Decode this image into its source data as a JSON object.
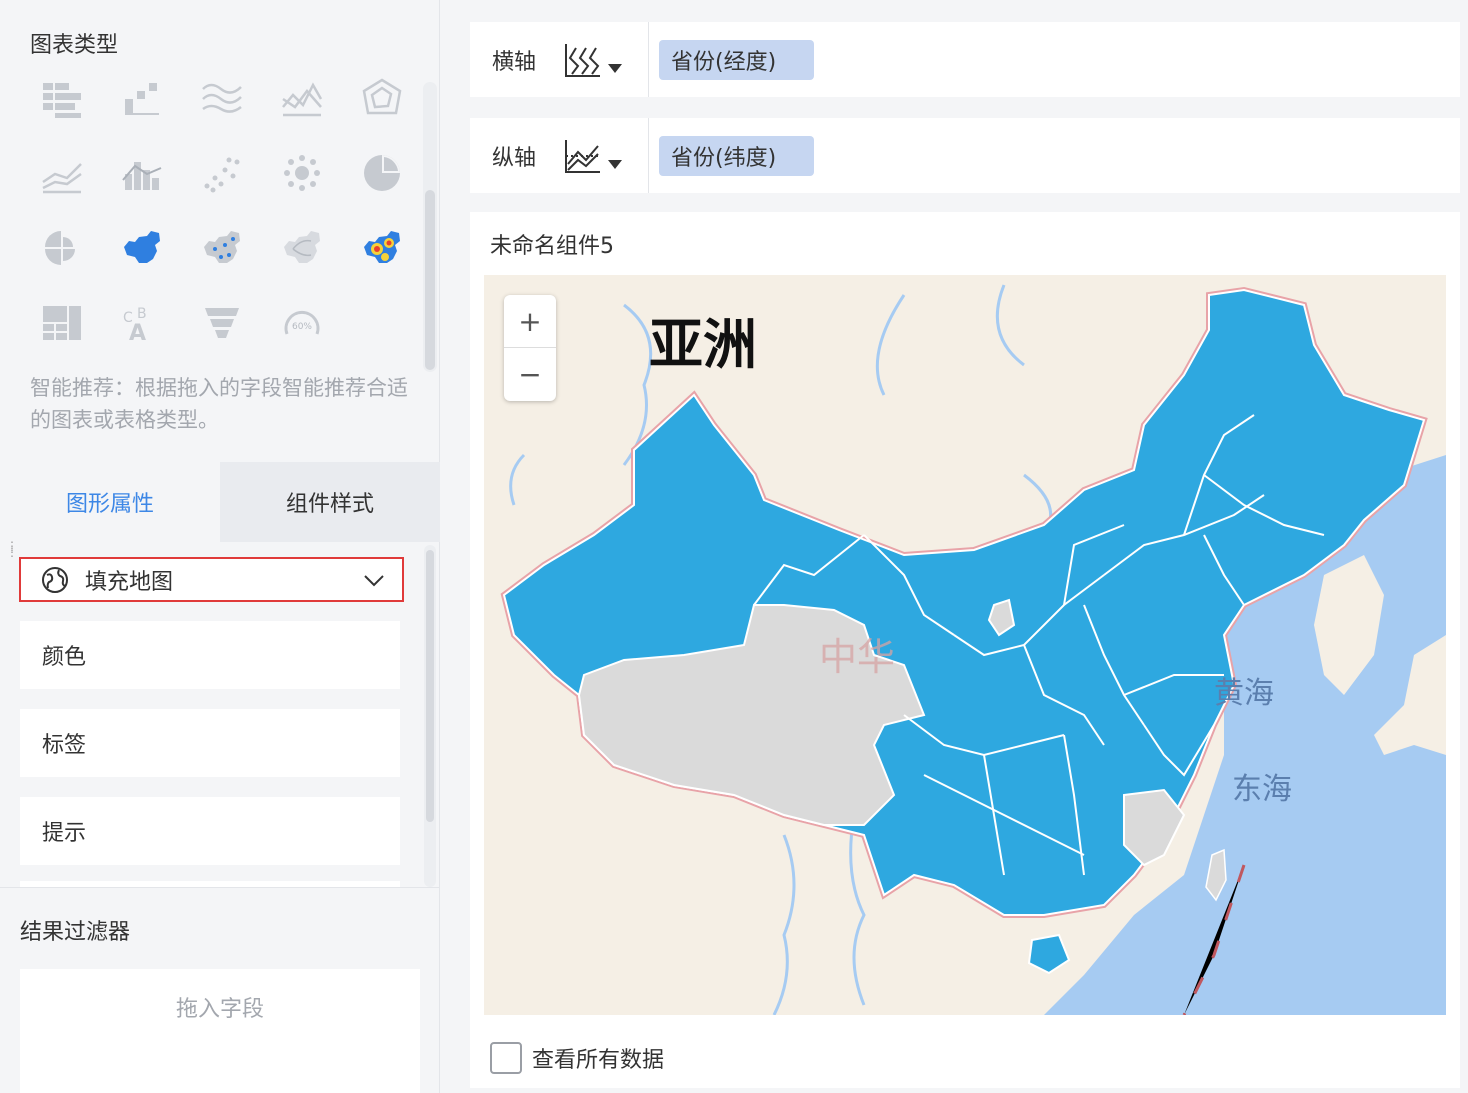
{
  "left_panel": {
    "chart_type_title": "图表类型",
    "chart_icons": [
      "grouped-table-icon",
      "cross-table-icon",
      "area-line-icon",
      "line-icon",
      "radar-icon",
      "multi-line-icon",
      "bar-combo-icon",
      "scatter-icon",
      "bubble-icon",
      "pie-icon",
      "rose-pie-icon",
      "filled-map-icon",
      "point-map-icon",
      "flow-map-icon",
      "heat-map-icon",
      "kpi-block-icon",
      "word-cloud-icon",
      "funnel-icon",
      "gauge-icon"
    ],
    "gauge_label": "60%",
    "hint": "智能推荐：根据拖入的字段智能推荐合适的图表或表格类型。",
    "tabs": {
      "graphic_props": "图形属性",
      "component_style": "组件样式"
    },
    "chart_subtype": "填充地图",
    "properties": [
      "颜色",
      "标签",
      "提示"
    ],
    "filter_title": "结果过滤器",
    "drop_placeholder": "拖入字段"
  },
  "axes": {
    "x_label": "横轴",
    "x_field": "省份(经度)",
    "y_label": "纵轴",
    "y_field": "省份(纬度)"
  },
  "widget": {
    "title": "未命名组件5",
    "zoom_in": "+",
    "zoom_out": "−",
    "map_labels": {
      "continent": "亚洲",
      "country": "中华",
      "sea_yellow": "黄海",
      "sea_east": "东海"
    },
    "view_all_data": "查看所有数据"
  },
  "colors": {
    "accent": "#3d87e6",
    "filled_region": "#2ea8e0",
    "unfilled_region": "#dadada",
    "sea": "#a6cbf2",
    "land": "#f5efe5",
    "highlight_border": "#e03a3a",
    "pill": "#c6d6f1"
  }
}
